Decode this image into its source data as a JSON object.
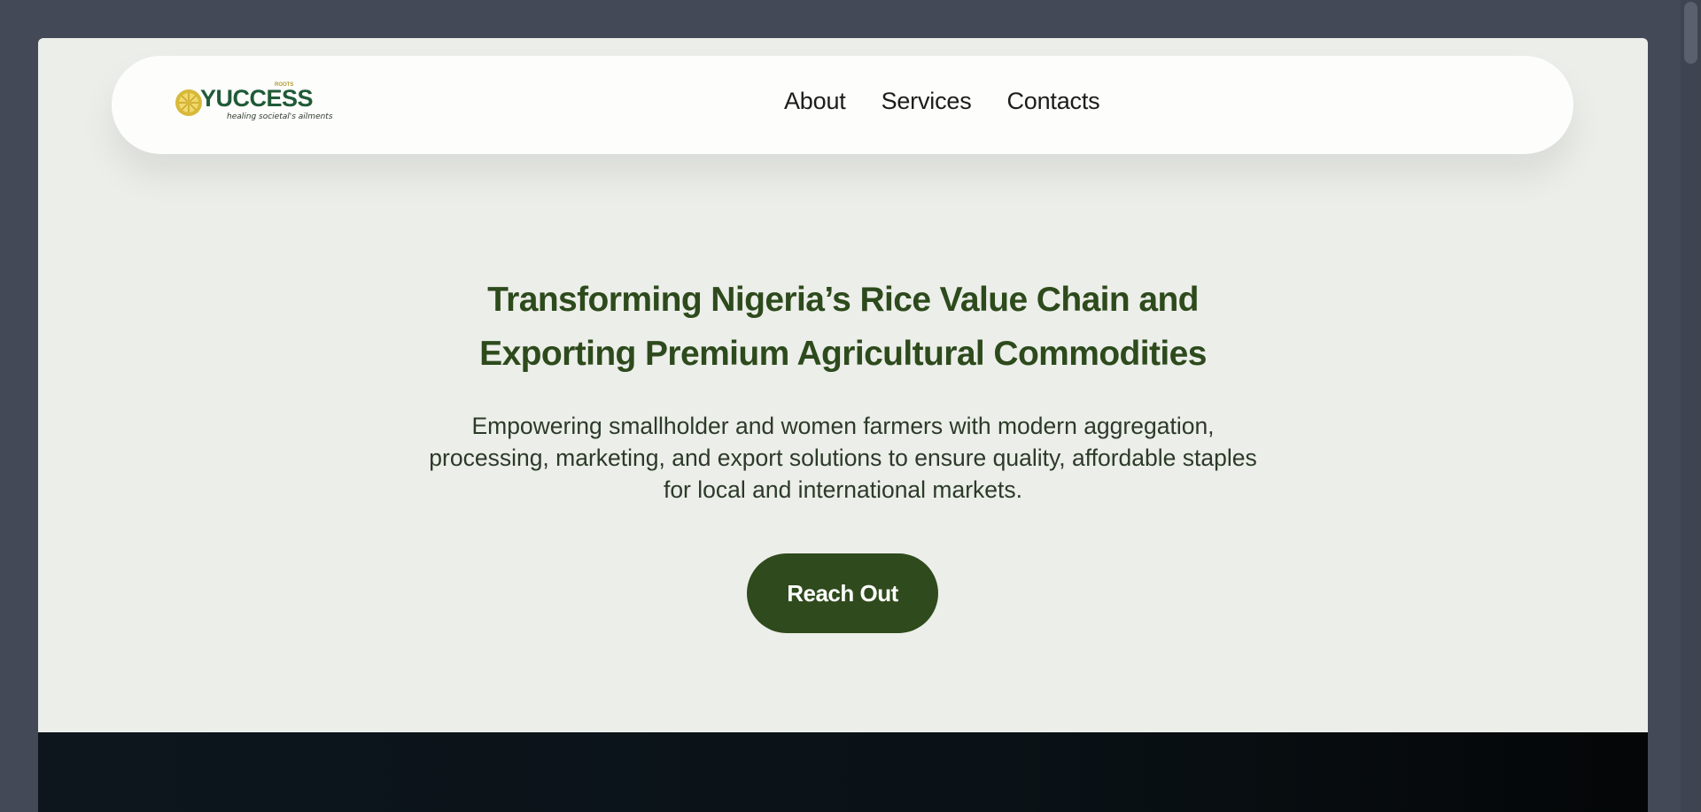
{
  "brand": {
    "name": "YUCCESS",
    "small_text": "ROOTS",
    "tagline": "healing societal's ailments",
    "logo_icon": "lemon-slice-icon",
    "colors": {
      "wordmark": "#1f5a36",
      "accent": "#b49a2e"
    }
  },
  "nav": {
    "links": [
      {
        "label": "About"
      },
      {
        "label": "Services"
      },
      {
        "label": "Contacts"
      }
    ]
  },
  "hero": {
    "title_lines": [
      "Transforming Nigeria’s Rice Value Chain and",
      "Exporting Premium Agricultural Commodities"
    ],
    "subtitle_lines": [
      "Empowering smallholder and women farmers with modern aggregation,",
      "processing, marketing, and export solutions to ensure quality, affordable staples",
      "for local and international markets."
    ],
    "cta_label": "Reach Out"
  },
  "colors": {
    "page_background": "#eceee9",
    "title": "#2d4a1c",
    "cta_background": "#2f4a1c",
    "dark_section": "#0d161d"
  }
}
